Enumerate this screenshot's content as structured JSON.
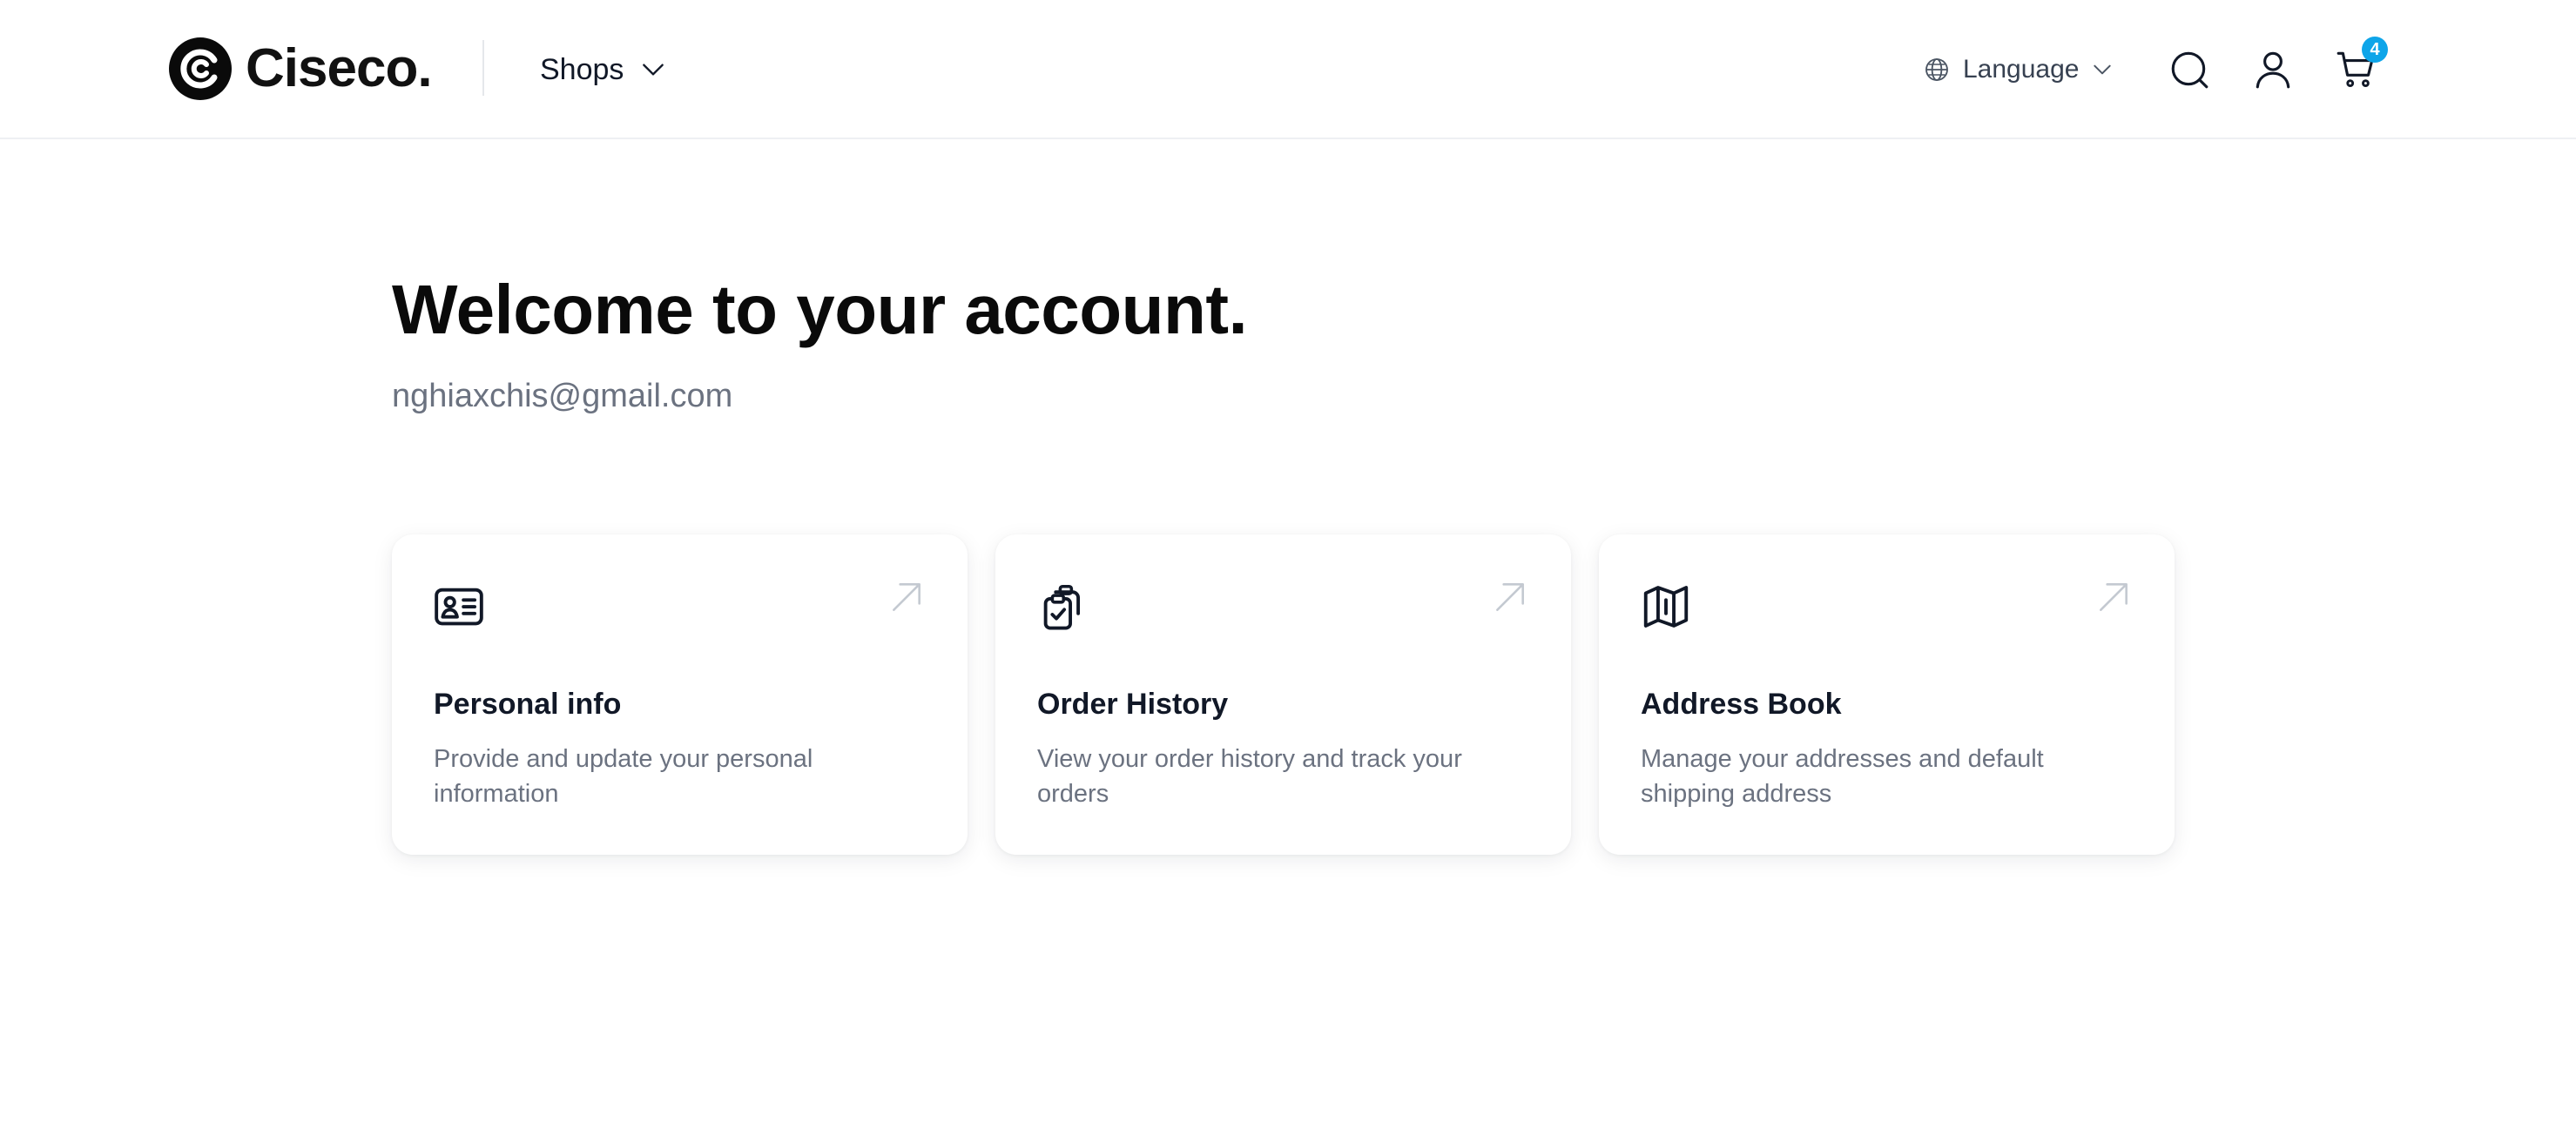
{
  "header": {
    "logo_text": "Ciseco.",
    "shops_label": "Shops",
    "language_label": "Language",
    "cart_count": "4",
    "icons": [
      "logo-icon",
      "chevron-down-icon",
      "globe-icon",
      "search-icon",
      "user-icon",
      "cart-icon"
    ]
  },
  "main": {
    "title": "Welcome to your account.",
    "email": "nghiaxchis@gmail.com"
  },
  "cards": [
    {
      "title": "Personal info",
      "description": "Provide and update your personal information",
      "icon": "id-card-icon"
    },
    {
      "title": "Order History",
      "description": "View your order history and track your orders",
      "icon": "clipboard-check-icon"
    },
    {
      "title": "Address Book",
      "description": "Manage your addresses and default shipping address",
      "icon": "map-icon"
    }
  ],
  "colors": {
    "badge": "#0ea5e9",
    "text_muted": "#6b7280",
    "text_dark": "#0a0a0a"
  }
}
